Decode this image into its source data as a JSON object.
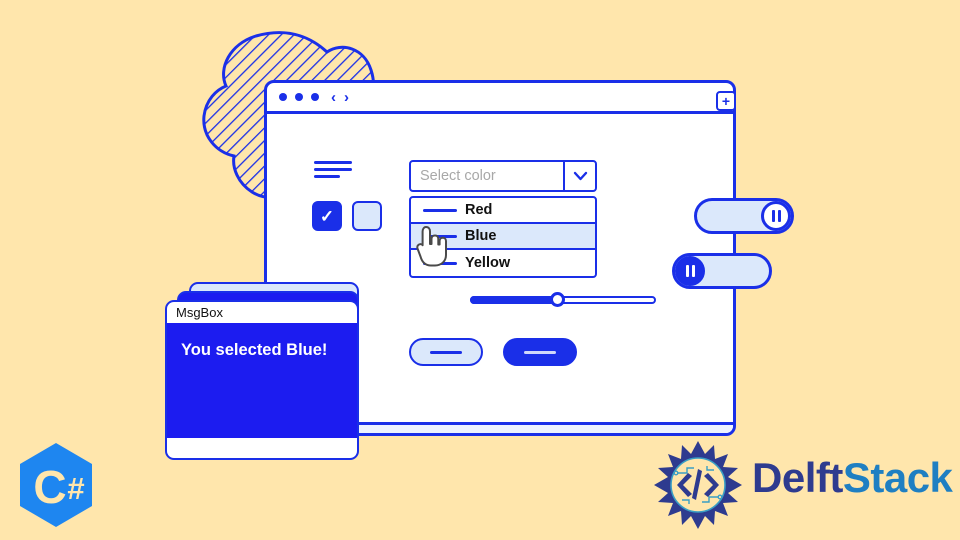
{
  "background_color": "#ffe6ac",
  "accent_color": "#1a2fe8",
  "window": {
    "titlebar": {
      "dots": 3,
      "back_icon": "chevron-left-icon",
      "forward_icon": "chevron-right-icon",
      "add_label": "+"
    },
    "select": {
      "placeholder": "Select color",
      "value": "",
      "caret_icon": "chevron-down-icon",
      "options": [
        {
          "label": "Red",
          "selected": false
        },
        {
          "label": "Blue",
          "selected": true
        },
        {
          "label": "Yellow",
          "selected": false
        }
      ]
    },
    "checkboxes": [
      {
        "name": "checkbox-checked",
        "checked": true,
        "glyph": "✓"
      },
      {
        "name": "checkbox-unchecked",
        "checked": false,
        "glyph": ""
      }
    ],
    "slider": {
      "value_percent": 47,
      "min": 0,
      "max": 100
    },
    "buttons": [
      {
        "name": "secondary-pill-button",
        "style": "outline"
      },
      {
        "name": "primary-pill-button",
        "style": "filled"
      }
    ]
  },
  "toggles": [
    {
      "name": "toggle-switch-on",
      "state": "on",
      "icon": "pause-icon"
    },
    {
      "name": "toggle-switch-off",
      "state": "off",
      "icon": "pause-icon"
    }
  ],
  "msgbox": {
    "title": "MsgBox",
    "message": "You selected Blue!"
  },
  "logos": {
    "csharp": {
      "label": "C#",
      "shape": "hexagon"
    },
    "delftstack": {
      "part1": "Delft",
      "part2": "Stack"
    }
  }
}
